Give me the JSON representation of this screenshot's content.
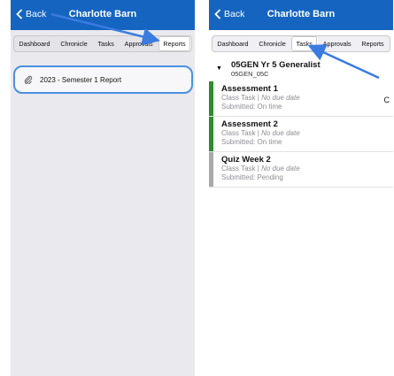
{
  "colors": {
    "nav": "#1565c0",
    "accent": "#4a90e2",
    "green": "#2e8b2e",
    "grey": "#a9a9a9"
  },
  "left": {
    "back_label": "Back",
    "title": "Charlotte Barn",
    "tabs": [
      "Dashboard",
      "Chronicle",
      "Tasks",
      "Approvals",
      "Reports"
    ],
    "active_tab": "Reports",
    "report": {
      "icon": "paperclip-icon",
      "label": "2023 - Semester 1 Report"
    }
  },
  "right": {
    "back_label": "Back",
    "title": "Charlotte Barn",
    "tabs": [
      "Dashboard",
      "Chronicle",
      "Tasks",
      "Approvals",
      "Reports"
    ],
    "active_tab": "Tasks",
    "group": {
      "title": "05GEN Yr 5 Generalist",
      "subtitle": "05GEN_05C"
    },
    "tasks": [
      {
        "title": "Assessment 1",
        "type": "Class Task",
        "due": "No due date",
        "submitted": "Submitted: On time",
        "right": "C",
        "status_color": "#2e8b2e"
      },
      {
        "title": "Assessment 2",
        "type": "Class Task",
        "due": "No due date",
        "submitted": "Submitted: On time",
        "right": "",
        "status_color": "#2e8b2e"
      },
      {
        "title": "Quiz Week 2",
        "type": "Class Task",
        "due": "No due date",
        "submitted": "Submitted: Pending",
        "right": "",
        "status_color": "#a9a9a9"
      }
    ]
  }
}
